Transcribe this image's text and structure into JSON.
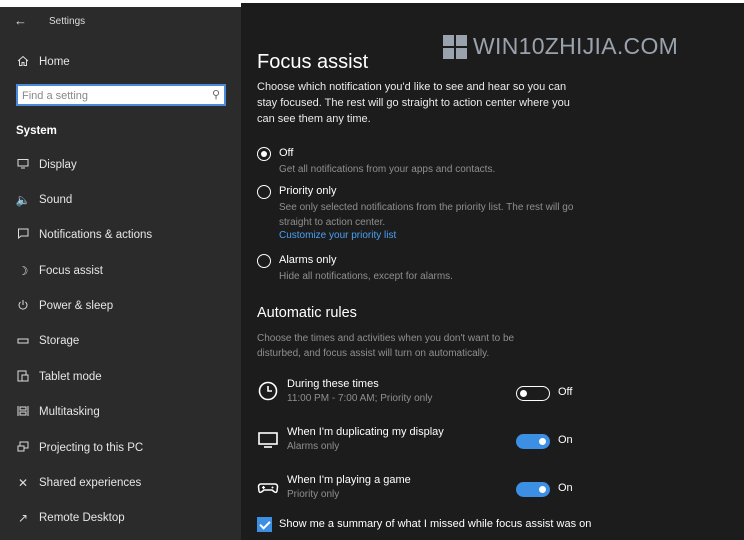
{
  "window": {
    "title": "Settings"
  },
  "watermark": "WIN10ZHIJIA.COM",
  "sidebar": {
    "home": "Home",
    "search_placeholder": "Find a setting",
    "section": "System",
    "items": [
      {
        "label": "Display",
        "icon": "monitor-icon"
      },
      {
        "label": "Sound",
        "icon": "speaker-icon"
      },
      {
        "label": "Notifications & actions",
        "icon": "notification-icon"
      },
      {
        "label": "Focus assist",
        "icon": "moon-icon"
      },
      {
        "label": "Power & sleep",
        "icon": "power-icon"
      },
      {
        "label": "Storage",
        "icon": "storage-icon"
      },
      {
        "label": "Tablet mode",
        "icon": "tablet-icon"
      },
      {
        "label": "Multitasking",
        "icon": "multitasking-icon"
      },
      {
        "label": "Projecting to this PC",
        "icon": "projector-icon"
      },
      {
        "label": "Shared experiences",
        "icon": "shared-icon"
      },
      {
        "label": "Remote Desktop",
        "icon": "remote-icon"
      }
    ]
  },
  "main": {
    "title": "Focus assist",
    "description": "Choose which notification you'd like to see and hear so you can stay focused. The rest will go straight to action center where you can see them any time.",
    "options": [
      {
        "label": "Off",
        "sub": "Get all notifications from your apps and contacts.",
        "selected": true
      },
      {
        "label": "Priority only",
        "sub": "See only selected notifications from the priority list. The rest will go straight to action center.",
        "link": "Customize your priority list",
        "selected": false
      },
      {
        "label": "Alarms only",
        "sub": "Hide all notifications, except for alarms.",
        "selected": false
      }
    ],
    "automatic_title": "Automatic rules",
    "automatic_desc": "Choose the times and activities when you don't want to be disturbed, and focus assist will turn on automatically.",
    "rules": [
      {
        "label": "During these times",
        "sub": "11:00 PM - 7:00 AM; Priority only",
        "state": "Off",
        "icon": "clock-icon"
      },
      {
        "label": "When I'm duplicating my display",
        "sub": "Alarms only",
        "state": "On",
        "icon": "display-icon"
      },
      {
        "label": "When I'm playing a game",
        "sub": "Priority only",
        "state": "On",
        "icon": "gamepad-icon"
      }
    ],
    "summary_checkbox": "Show me a summary of what I missed while focus assist was on"
  },
  "colors": {
    "accent": "#3c8fe3",
    "link": "#4aa0f5",
    "sidebar_bg": "#2b2b2b",
    "main_bg": "#1c1c1c"
  }
}
